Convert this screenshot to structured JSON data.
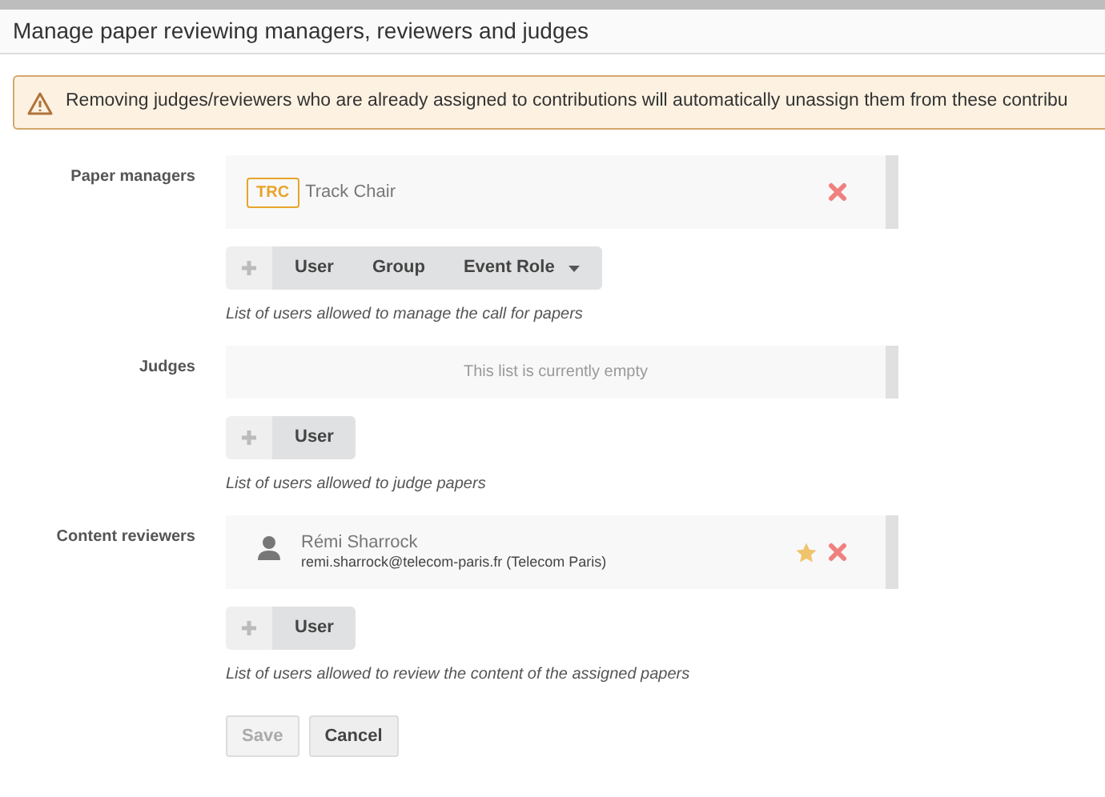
{
  "dialog": {
    "title": "Manage paper reviewing managers, reviewers and judges"
  },
  "warning": {
    "text": "Removing judges/reviewers who are already assigned to contributions will automatically unassign them from these contribu"
  },
  "sections": [
    {
      "label": "Paper managers",
      "entries": [
        {
          "kind": "role",
          "badge": "TRC",
          "name": "Track Chair",
          "starred": false
        }
      ],
      "add_buttons": [
        {
          "label": "User",
          "dropdown": false
        },
        {
          "label": "Group",
          "dropdown": false
        },
        {
          "label": "Event Role",
          "dropdown": true
        }
      ],
      "hint": "List of users allowed to manage the call for papers"
    },
    {
      "label": "Judges",
      "empty_text": "This list is currently empty",
      "add_buttons": [
        {
          "label": "User",
          "dropdown": false
        }
      ],
      "hint": "List of users allowed to judge papers"
    },
    {
      "label": "Content reviewers",
      "entries": [
        {
          "kind": "user",
          "name": "Rémi Sharrock",
          "detail": "remi.sharrock@telecom-paris.fr (Telecom Paris)",
          "starred": true
        }
      ],
      "add_buttons": [
        {
          "label": "User",
          "dropdown": false
        }
      ],
      "hint": "List of users allowed to review the content of the assigned papers"
    }
  ],
  "actions": [
    {
      "label": "Save",
      "disabled": true
    },
    {
      "label": "Cancel",
      "disabled": false
    }
  ]
}
